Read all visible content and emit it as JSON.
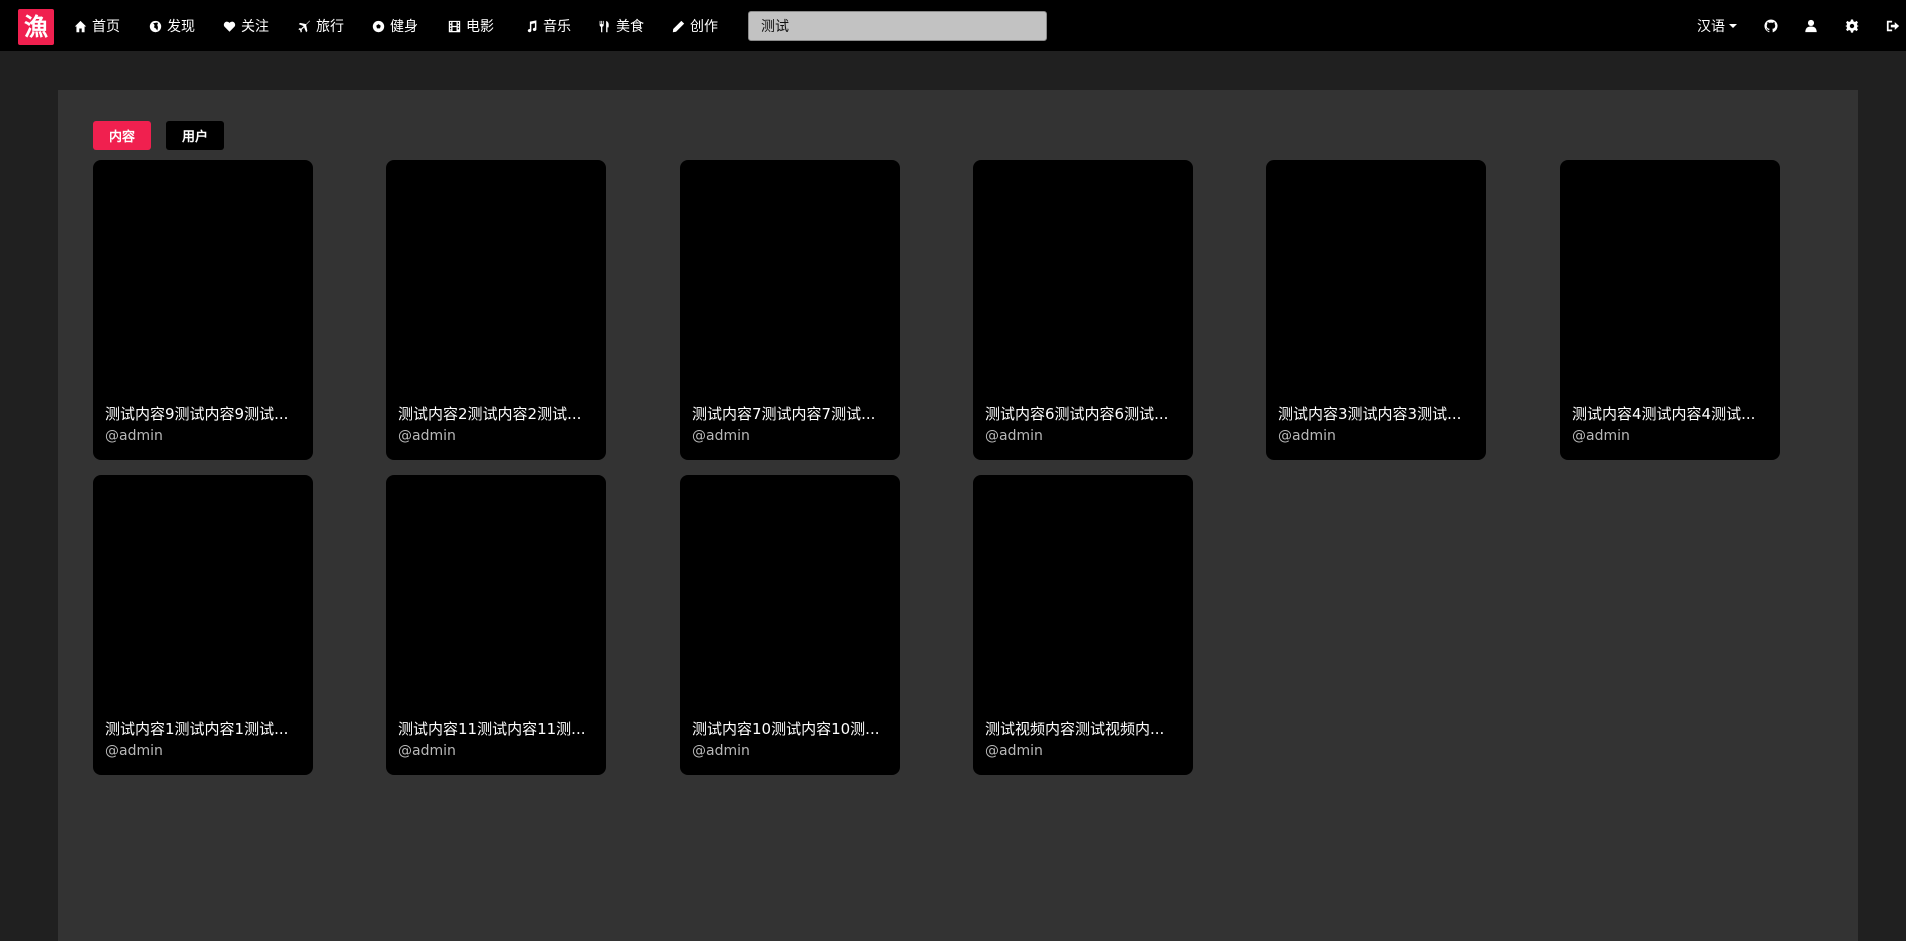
{
  "logo": {
    "text": "漁",
    "color": "#f0204f"
  },
  "nav": {
    "items": [
      {
        "label": "首页",
        "icon": "home-icon"
      },
      {
        "label": "发现",
        "icon": "globe-icon"
      },
      {
        "label": "关注",
        "icon": "heart-icon"
      },
      {
        "label": "旅行",
        "icon": "plane-icon"
      },
      {
        "label": "健身",
        "icon": "soccer-ball-icon"
      },
      {
        "label": "电影",
        "icon": "film-icon"
      },
      {
        "label": "音乐",
        "icon": "music-icon"
      },
      {
        "label": "美食",
        "icon": "cutlery-icon"
      },
      {
        "label": "创作",
        "icon": "pencil-icon"
      }
    ],
    "search_value": "测试",
    "language": "汉语",
    "right_icons": [
      "github-icon",
      "user-icon",
      "gear-icon",
      "sign-out-icon"
    ]
  },
  "tabs": [
    {
      "label": "内容",
      "active": true
    },
    {
      "label": "用户",
      "active": false
    }
  ],
  "cards": [
    {
      "title": "测试内容9测试内容9测试...",
      "author": "@admin"
    },
    {
      "title": "测试内容2测试内容2测试...",
      "author": "@admin"
    },
    {
      "title": "测试内容7测试内容7测试...",
      "author": "@admin"
    },
    {
      "title": "测试内容6测试内容6测试...",
      "author": "@admin"
    },
    {
      "title": "测试内容3测试内容3测试...",
      "author": "@admin"
    },
    {
      "title": "测试内容4测试内容4测试...",
      "author": "@admin"
    },
    {
      "title": "测试内容1测试内容1测试...",
      "author": "@admin"
    },
    {
      "title": "测试内容11测试内容11测...",
      "author": "@admin"
    },
    {
      "title": "测试内容10测试内容10测...",
      "author": "@admin"
    },
    {
      "title": "测试视频内容测试视频内...",
      "author": "@admin"
    }
  ],
  "colors": {
    "accent": "#f0204f",
    "background": "#202020",
    "panel": "#333333",
    "card": "#000000"
  }
}
